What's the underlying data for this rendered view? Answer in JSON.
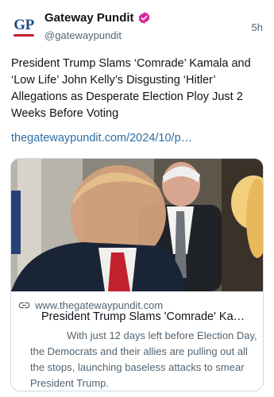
{
  "author": {
    "avatar_text": "GP",
    "display_name": "Gateway Pundit",
    "handle": "@gatewaypundit",
    "timestamp": "5h",
    "verified_color": "#d6269b",
    "brand_color": "#1d4b8f",
    "brand_accent": "#c8202f"
  },
  "post": {
    "text": "President Trump Slams ‘Comrade’ Kamala and ‘Low Life’ John Kelly’s Disgusting ‘Hitler’ Allegations as Desperate Election Ploy Just 2 Weeks Before Voting",
    "link_text": "thegatewaypundit.com/2024/10/p…",
    "link_color": "#2d6da3"
  },
  "card": {
    "domain": "www.thegatewaypundit.com",
    "title": "President Trump Slams 'Comrade' Ka…",
    "description": "With just 12 days left before Election Day, the Democrats and their allies are pulling out all the stops, launching baseless attacks to smear President Trump.",
    "icon": "link-icon"
  }
}
